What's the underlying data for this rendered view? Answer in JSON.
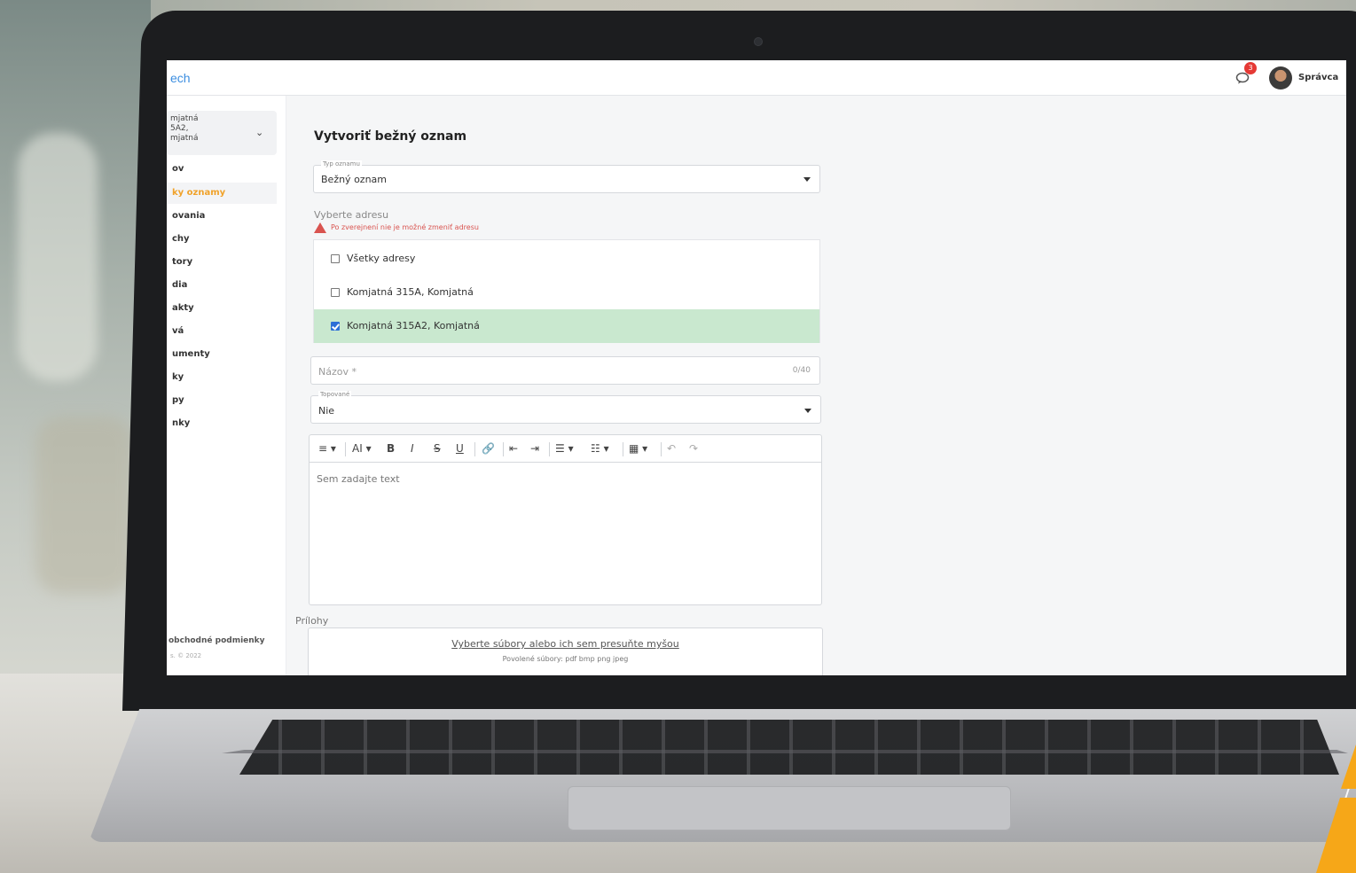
{
  "header": {
    "brand": "ech",
    "notification_count": "3",
    "user_name": "Správca"
  },
  "sidebar": {
    "address_select": {
      "lines": [
        "mjatná",
        "5A2,",
        "mjatná"
      ]
    },
    "items": [
      {
        "label": "ov"
      },
      {
        "label": "ky oznamy"
      },
      {
        "label": "ovania"
      },
      {
        "label": "chy"
      },
      {
        "label": "tory"
      },
      {
        "label": "dia"
      },
      {
        "label": "akty"
      },
      {
        "label": "vá"
      },
      {
        "label": "umenty"
      },
      {
        "label": "ky"
      },
      {
        "label": "py"
      },
      {
        "label": "nky"
      }
    ],
    "active_index": 1,
    "footer_terms": "obchodné podmienky",
    "footer_copy": "s. © 2022"
  },
  "form": {
    "title": "Vytvoriť bežný oznam",
    "type_field": {
      "label": "Typ oznamu",
      "value": "Bežný oznam"
    },
    "address_heading": "Vyberte adresu",
    "address_warning": "Po zverejnení nie je možné zmeniť adresu",
    "addresses": [
      {
        "label": "Všetky adresy",
        "checked": false
      },
      {
        "label": "Komjatná 315A, Komjatná",
        "checked": false
      },
      {
        "label": "Komjatná 315A2, Komjatná",
        "checked": true
      }
    ],
    "name_field": {
      "placeholder": "Názov *",
      "counter": "0/40"
    },
    "pinned_field": {
      "label": "Topované",
      "value": "Nie"
    },
    "editor": {
      "toolbar": [
        "≡ ▾",
        "AI ▾",
        "B",
        "I",
        "S",
        "U",
        "🔗",
        "⇤",
        "⇥",
        "☰ ▾",
        "☷ ▾",
        "▦ ▾",
        "↶",
        "↷"
      ],
      "placeholder": "Sem zadajte text"
    },
    "attachments": {
      "label": "Prílohy",
      "link": "Vyberte súbory alebo ich sem presuňte myšou",
      "allowed": "Povolené súbory: pdf bmp png jpeg"
    }
  },
  "colors": {
    "accent": "#f0a22a",
    "brand_link": "#3c8ee0",
    "selected_row": "#c9e8cf",
    "warning": "#d9534f"
  }
}
